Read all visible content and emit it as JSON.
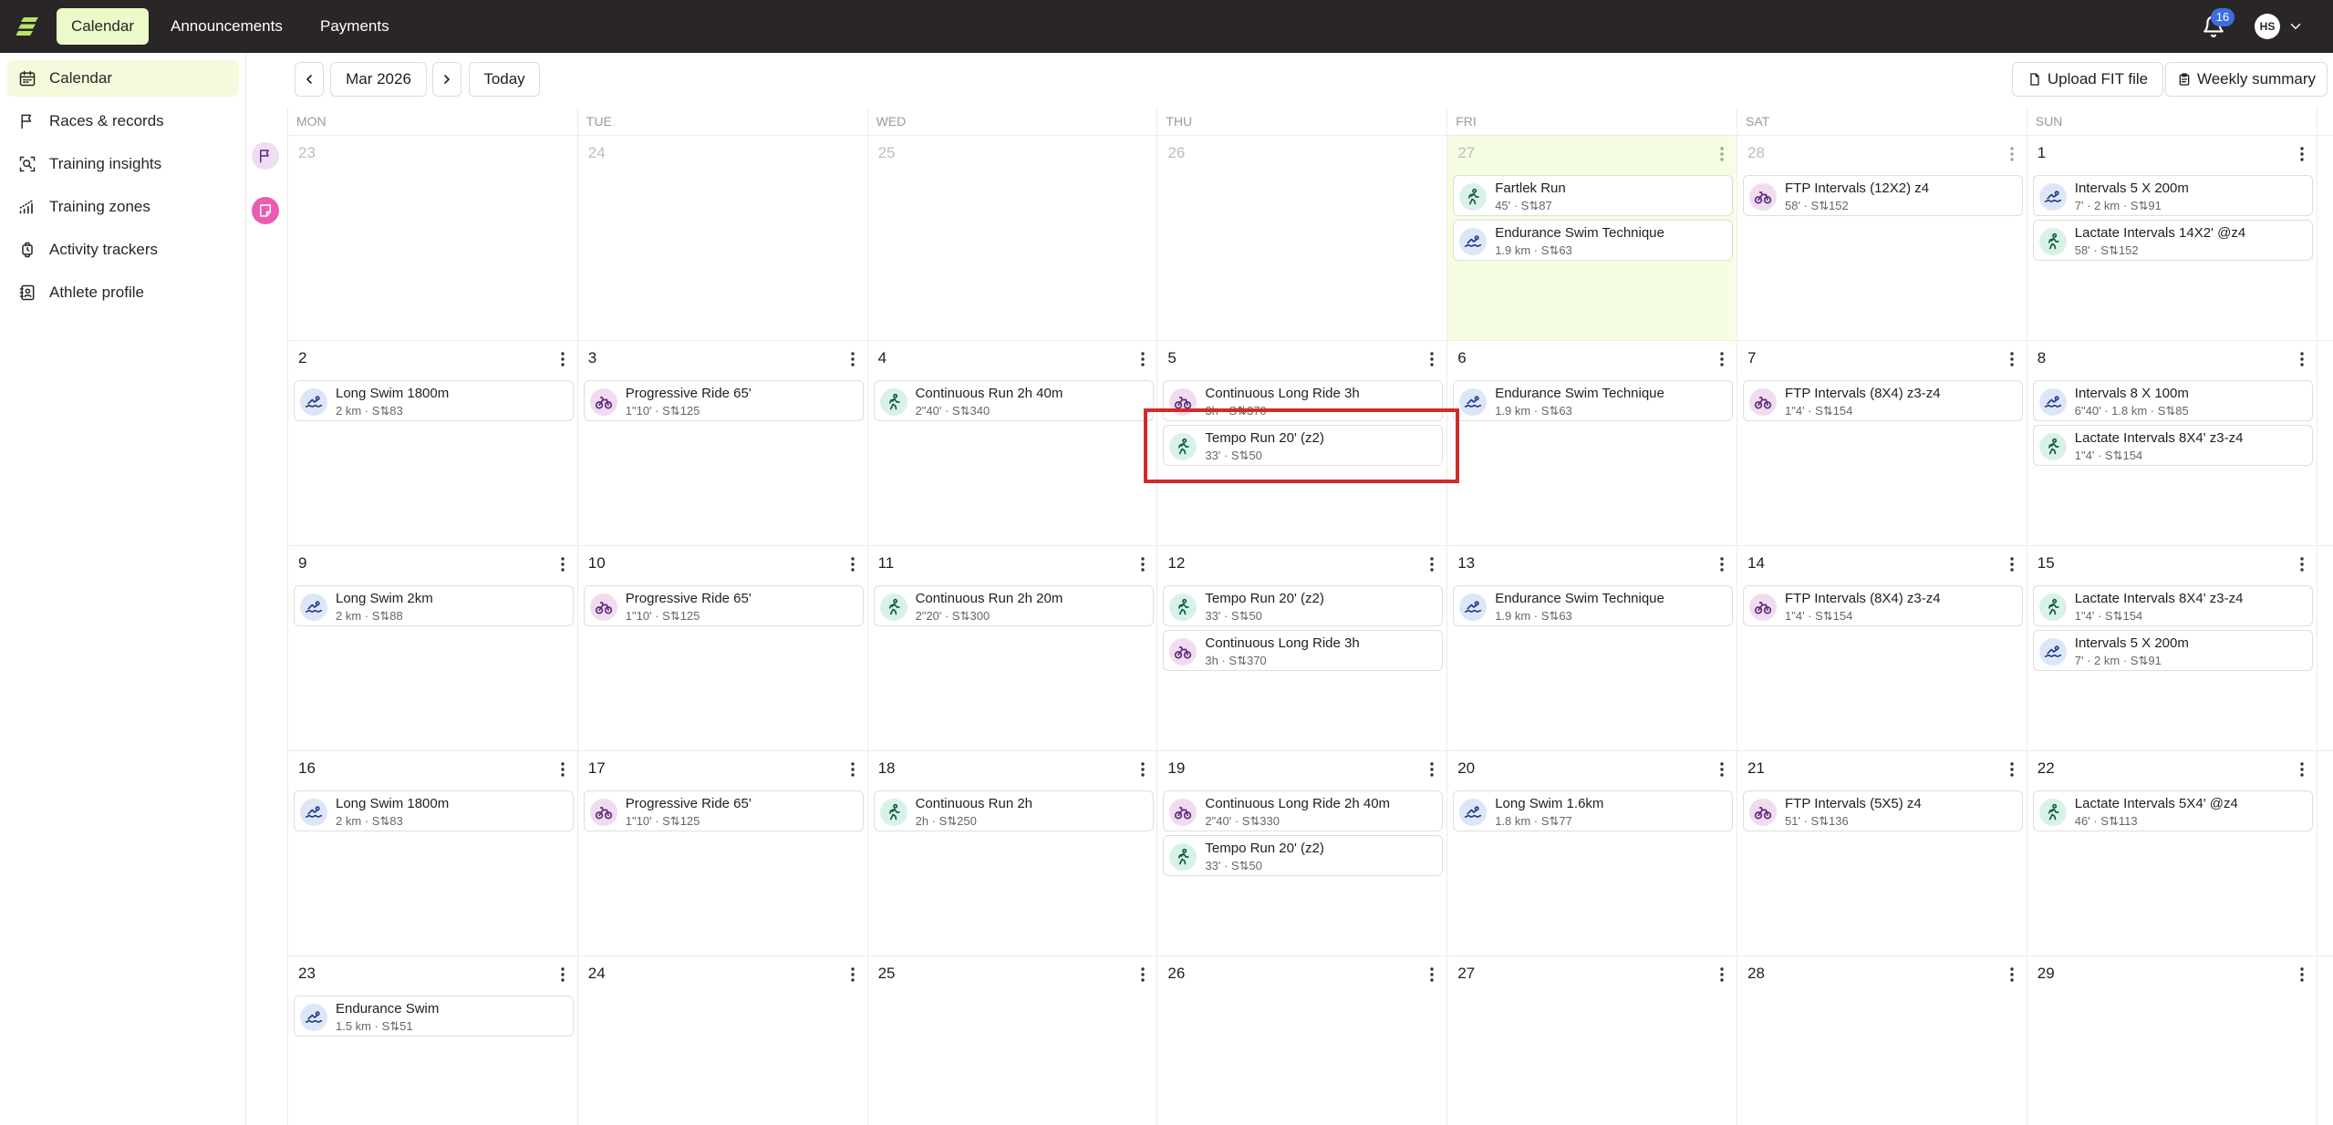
{
  "topbar": {
    "nav": [
      {
        "label": "Calendar",
        "active": true
      },
      {
        "label": "Announcements",
        "active": false
      },
      {
        "label": "Payments",
        "active": false
      }
    ],
    "notifications_count": "16",
    "avatar_initials": "HS",
    "accent": "#ecf9c8",
    "background": "#2a2526"
  },
  "sidebar": {
    "items": [
      {
        "label": "Calendar",
        "icon": "calendar-icon",
        "active": true
      },
      {
        "label": "Races & records",
        "icon": "flag-icon",
        "active": false
      },
      {
        "label": "Training insights",
        "icon": "insights-icon",
        "active": false
      },
      {
        "label": "Training zones",
        "icon": "zones-icon",
        "active": false
      },
      {
        "label": "Activity trackers",
        "icon": "watch-icon",
        "active": false
      },
      {
        "label": "Athlete profile",
        "icon": "profile-icon",
        "active": false
      }
    ]
  },
  "toolbar": {
    "month": "Mar 2026",
    "today": "Today",
    "upload": "Upload FIT file",
    "weekly": "Weekly summary"
  },
  "calendar": {
    "weekdays": [
      "MON",
      "TUE",
      "WED",
      "THU",
      "FRI",
      "SAT",
      "SUN"
    ],
    "weeks": [
      [
        {
          "num": "23",
          "dim": true,
          "events": []
        },
        {
          "num": "24",
          "dim": true,
          "events": []
        },
        {
          "num": "25",
          "dim": true,
          "events": []
        },
        {
          "num": "26",
          "dim": true,
          "events": []
        },
        {
          "num": "27",
          "dim": true,
          "today": true,
          "events": [
            {
              "type": "run",
              "title": "Fartlek Run",
              "meta": "45' · S⇅87"
            },
            {
              "type": "swim",
              "title": "Endurance Swim Technique",
              "meta": "1.9 km · S⇅63"
            }
          ]
        },
        {
          "num": "28",
          "dim": true,
          "events": [
            {
              "type": "bike",
              "title": "FTP Intervals (12X2) z4",
              "meta": "58' · S⇅152"
            }
          ]
        },
        {
          "num": "1",
          "dim": false,
          "events": [
            {
              "type": "swim",
              "title": "Intervals 5 X 200m",
              "meta": "7' · 2 km · S⇅91"
            },
            {
              "type": "run",
              "title": "Lactate Intervals 14X2' @z4",
              "meta": "58' · S⇅152"
            }
          ]
        }
      ],
      [
        {
          "num": "2",
          "events": [
            {
              "type": "swim",
              "title": "Long Swim 1800m",
              "meta": "2 km · S⇅83"
            }
          ]
        },
        {
          "num": "3",
          "events": [
            {
              "type": "bike",
              "title": "Progressive Ride 65'",
              "meta": "1\"10' · S⇅125"
            }
          ]
        },
        {
          "num": "4",
          "events": [
            {
              "type": "run",
              "title": "Continuous Run 2h 40m",
              "meta": "2\"40' · S⇅340"
            }
          ]
        },
        {
          "num": "5",
          "events": [
            {
              "type": "bike",
              "title": "Continuous Long Ride 3h",
              "meta": "3h · S⇅370"
            },
            {
              "type": "run",
              "title": "Tempo Run 20' (z2)",
              "meta": "33' · S⇅50"
            }
          ]
        },
        {
          "num": "6",
          "events": [
            {
              "type": "swim",
              "title": "Endurance Swim Technique",
              "meta": "1.9 km · S⇅63"
            }
          ]
        },
        {
          "num": "7",
          "events": [
            {
              "type": "bike",
              "title": "FTP Intervals (8X4) z3-z4",
              "meta": "1\"4' · S⇅154"
            }
          ]
        },
        {
          "num": "8",
          "events": [
            {
              "type": "swim",
              "title": "Intervals 8 X 100m",
              "meta": "6\"40' · 1.8 km · S⇅85"
            },
            {
              "type": "run",
              "title": "Lactate Intervals 8X4' z3-z4",
              "meta": "1\"4' · S⇅154"
            }
          ]
        }
      ],
      [
        {
          "num": "9",
          "events": [
            {
              "type": "swim",
              "title": "Long Swim 2km",
              "meta": "2 km · S⇅88"
            }
          ]
        },
        {
          "num": "10",
          "events": [
            {
              "type": "bike",
              "title": "Progressive Ride 65'",
              "meta": "1\"10' · S⇅125"
            }
          ]
        },
        {
          "num": "11",
          "events": [
            {
              "type": "run",
              "title": "Continuous Run 2h 20m",
              "meta": "2\"20' · S⇅300"
            }
          ]
        },
        {
          "num": "12",
          "events": [
            {
              "type": "run",
              "title": "Tempo Run 20' (z2)",
              "meta": "33' · S⇅50"
            },
            {
              "type": "bike",
              "title": "Continuous Long Ride 3h",
              "meta": "3h · S⇅370"
            }
          ]
        },
        {
          "num": "13",
          "events": [
            {
              "type": "swim",
              "title": "Endurance Swim Technique",
              "meta": "1.9 km · S⇅63"
            }
          ]
        },
        {
          "num": "14",
          "events": [
            {
              "type": "bike",
              "title": "FTP Intervals (8X4) z3-z4",
              "meta": "1\"4' · S⇅154"
            }
          ]
        },
        {
          "num": "15",
          "events": [
            {
              "type": "run",
              "title": "Lactate Intervals 8X4' z3-z4",
              "meta": "1\"4' · S⇅154"
            },
            {
              "type": "swim",
              "title": "Intervals 5 X 200m",
              "meta": "7' · 2 km · S⇅91"
            }
          ]
        }
      ],
      [
        {
          "num": "16",
          "events": [
            {
              "type": "swim",
              "title": "Long Swim 1800m",
              "meta": "2 km · S⇅83"
            }
          ]
        },
        {
          "num": "17",
          "events": [
            {
              "type": "bike",
              "title": "Progressive Ride 65'",
              "meta": "1\"10' · S⇅125"
            }
          ]
        },
        {
          "num": "18",
          "events": [
            {
              "type": "run",
              "title": "Continuous Run 2h",
              "meta": "2h · S⇅250"
            }
          ]
        },
        {
          "num": "19",
          "events": [
            {
              "type": "bike",
              "title": "Continuous Long Ride 2h 40m",
              "meta": "2\"40' · S⇅330"
            },
            {
              "type": "run",
              "title": "Tempo Run 20' (z2)",
              "meta": "33' · S⇅50"
            }
          ]
        },
        {
          "num": "20",
          "events": [
            {
              "type": "swim",
              "title": "Long Swim 1.6km",
              "meta": "1.8 km · S⇅77"
            }
          ]
        },
        {
          "num": "21",
          "events": [
            {
              "type": "bike",
              "title": "FTP Intervals (5X5) z4",
              "meta": "51' · S⇅136"
            }
          ]
        },
        {
          "num": "22",
          "events": [
            {
              "type": "run",
              "title": "Lactate Intervals 5X4' @z4",
              "meta": "46' · S⇅113"
            }
          ]
        }
      ],
      [
        {
          "num": "23",
          "events": [
            {
              "type": "swim",
              "title": "Endurance Swim",
              "meta": "1.5 km · S⇅51"
            }
          ]
        },
        {
          "num": "24",
          "events": []
        },
        {
          "num": "25",
          "events": []
        },
        {
          "num": "26",
          "events": []
        },
        {
          "num": "27",
          "events": []
        },
        {
          "num": "28",
          "events": []
        },
        {
          "num": "29",
          "events": []
        }
      ]
    ]
  }
}
